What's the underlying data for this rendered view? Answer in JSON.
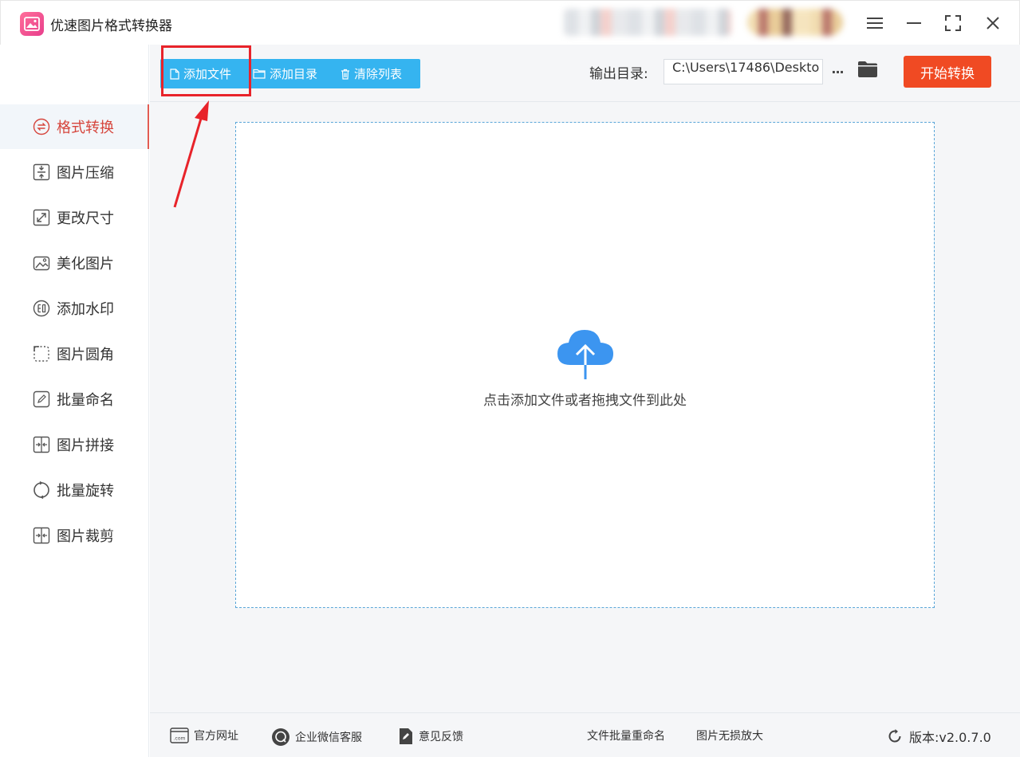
{
  "app": {
    "title": "优速图片格式转换器",
    "accent": "#35b4f0",
    "start_color": "#f04a23"
  },
  "sidebar": {
    "items": [
      {
        "label": "格式转换",
        "icon": "convert-icon",
        "active": true
      },
      {
        "label": "图片压缩",
        "icon": "compress-icon"
      },
      {
        "label": "更改尺寸",
        "icon": "resize-icon"
      },
      {
        "label": "美化图片",
        "icon": "beautify-icon"
      },
      {
        "label": "添加水印",
        "icon": "watermark-icon"
      },
      {
        "label": "图片圆角",
        "icon": "rounded-corner-icon"
      },
      {
        "label": "批量命名",
        "icon": "rename-icon"
      },
      {
        "label": "图片拼接",
        "icon": "stitch-icon"
      },
      {
        "label": "批量旋转",
        "icon": "rotate-icon"
      },
      {
        "label": "图片裁剪",
        "icon": "crop-icon"
      }
    ]
  },
  "toolbar": {
    "add_file": "添加文件",
    "add_dir": "添加目录",
    "clear_list": "清除列表",
    "output_label": "输出目录:",
    "output_path": "C:\\Users\\17486\\Deskto",
    "more": "···",
    "start": "开始转换"
  },
  "dropzone": {
    "hint": "点击添加文件或者拖拽文件到此处",
    "icon": "cloud-upload-icon"
  },
  "footer": {
    "website": "官方网址",
    "wechat": "企业微信客服",
    "feedback": "意见反馈",
    "batch_rename": "文件批量重命名",
    "upscale": "图片无损放大",
    "version": "版本:v2.0.7.0"
  }
}
